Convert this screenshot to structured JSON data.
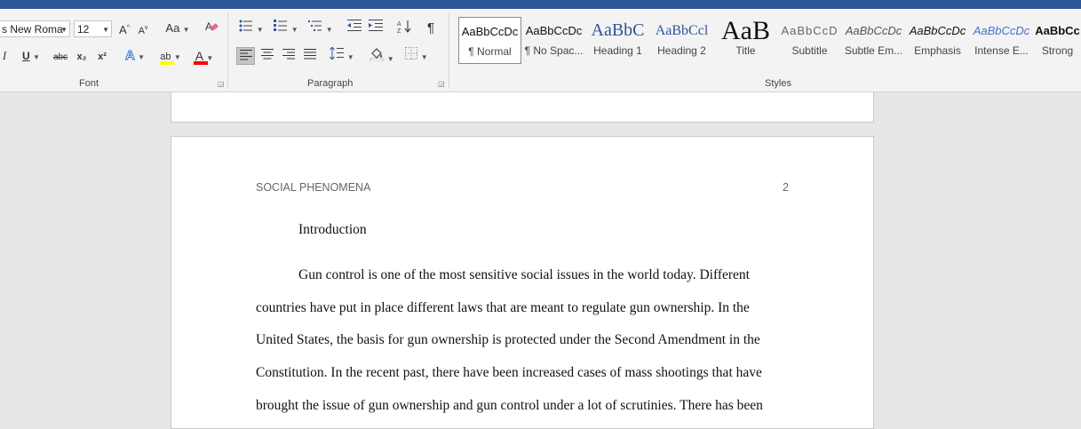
{
  "ribbon": {
    "font": {
      "label": "Font",
      "font_name": "s New Roma",
      "font_size": "12",
      "grow_label": "A",
      "shrink_label": "A",
      "change_case_label": "Aa",
      "italic": "I",
      "underline": "U",
      "strikethrough": "abc",
      "subscript": "x₂",
      "superscript": "x²",
      "text_effects": "A",
      "highlight": "ab",
      "font_color": "A"
    },
    "paragraph": {
      "label": "Paragraph"
    },
    "styles": {
      "label": "Styles",
      "items": [
        {
          "sample": "AaBbCcDc",
          "name": "¶ Normal"
        },
        {
          "sample": "AaBbCcDc",
          "name": "¶ No Spac..."
        },
        {
          "sample": "AaBbC",
          "name": "Heading 1"
        },
        {
          "sample": "AaBbCcl",
          "name": "Heading 2"
        },
        {
          "sample": "AaB",
          "name": "Title"
        },
        {
          "sample": "AaBbCcD",
          "name": "Subtitle"
        },
        {
          "sample": "AaBbCcDc",
          "name": "Subtle Em..."
        },
        {
          "sample": "AaBbCcDc",
          "name": "Emphasis"
        },
        {
          "sample": "AaBbCcDc",
          "name": "Intense E..."
        },
        {
          "sample": "AaBbCc",
          "name": "Strong"
        }
      ]
    }
  },
  "document": {
    "running_head": "SOCIAL PHENOMENA",
    "page_number": "2",
    "heading": "Introduction",
    "lines": [
      "Gun control is one of the most sensitive social issues in the world today.  Different",
      "countries have put in place different laws that are meant to regulate gun ownership. In the",
      "United States, the basis for gun ownership is protected under the Second Amendment in the",
      "Constitution. In the recent past, there have been increased cases of mass shootings that have",
      "brought the issue of gun ownership and gun control under a lot of scrutinies. There has been"
    ]
  },
  "colors": {
    "titlebar": "#2b579a",
    "heading_blue": "#2f5496",
    "highlight_yellow": "#ffff00",
    "font_red": "#ff0000"
  }
}
